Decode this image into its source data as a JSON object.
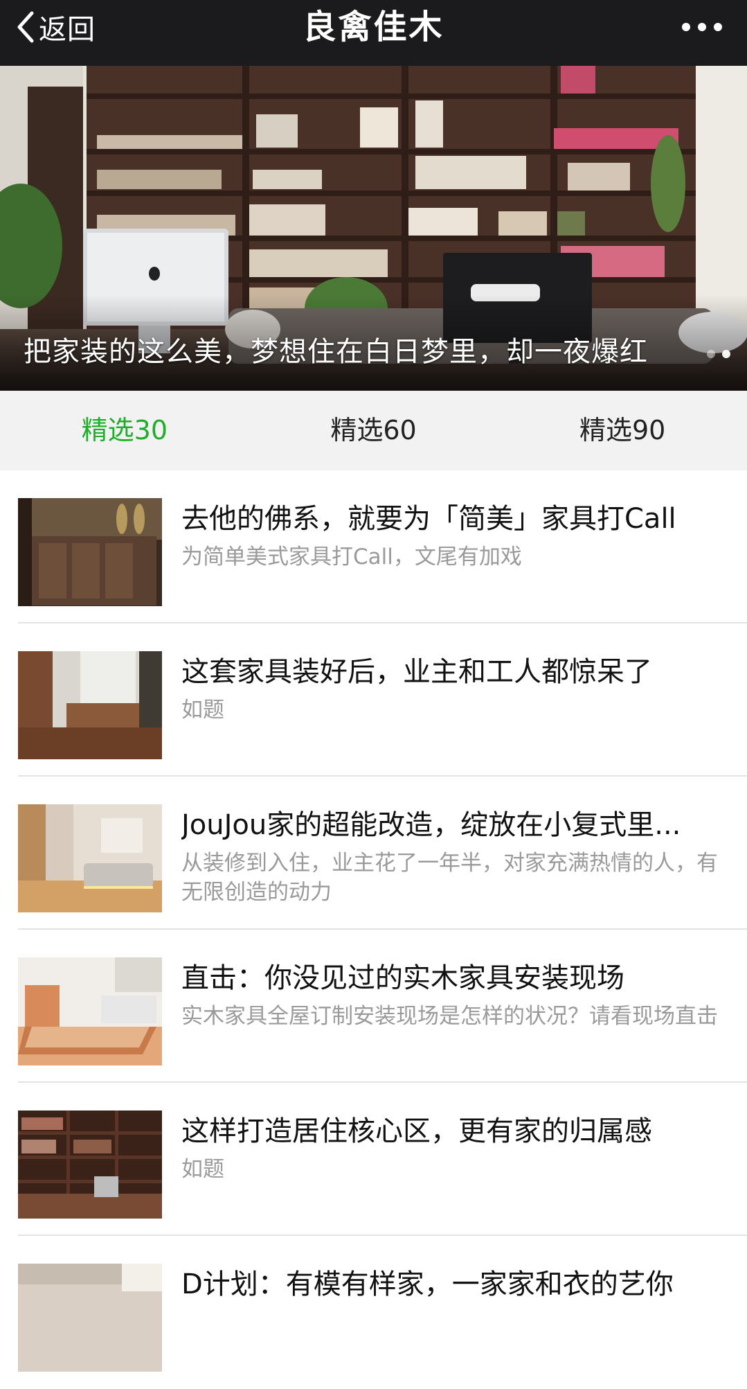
{
  "navbar": {
    "back_label": "返回",
    "title": "良禽佳木",
    "icons": {
      "back": "chevron-left-icon",
      "more": "more-dots-icon"
    }
  },
  "banner": {
    "caption": "把家装的这么美，梦想住在白日梦里，却一夜爆红",
    "slide_count": 2,
    "active_slide": 2
  },
  "tabs": [
    {
      "label": "精选30",
      "active": true
    },
    {
      "label": "精选60",
      "active": false
    },
    {
      "label": "精选90",
      "active": false
    }
  ],
  "colors": {
    "navbar_bg": "#1b1b1d",
    "tab_active": "#1fae2a",
    "tab_bar_bg": "#f2f2f2",
    "title_text": "#111111",
    "desc_text": "#9a9a9a"
  },
  "articles": [
    {
      "title": "去他的佛系，就要为「简美」家具打Call",
      "desc": "为简单美式家具打Call，文尾有加戏"
    },
    {
      "title": "这套家具装好后，业主和工人都惊呆了",
      "desc": "如题"
    },
    {
      "title": "JouJou家的超能改造，绽放在小复式里...",
      "desc": "从装修到入住，业主花了一年半，对家充满热情的人，有无限创造的动力"
    },
    {
      "title": "直击：你没见过的实木家具安装现场",
      "desc": "实木家具全屋订制安装现场是怎样的状况？请看现场直击"
    },
    {
      "title": "这样打造居住核心区，更有家的归属感",
      "desc": "如题"
    },
    {
      "title": "D计划：有模有样家，一家家和衣的艺你",
      "desc": ""
    }
  ]
}
